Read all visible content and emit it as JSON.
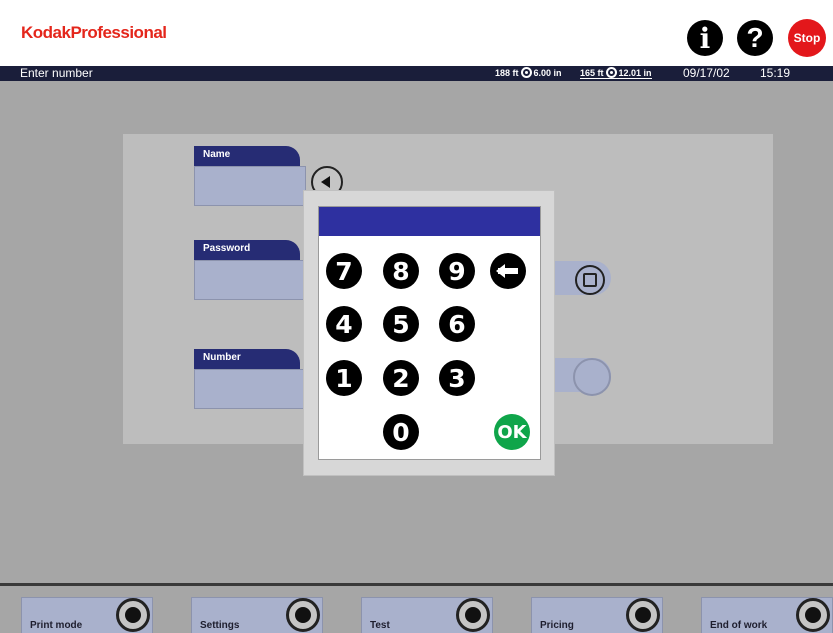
{
  "header": {
    "brand_bold": "Kodak",
    "brand_rest": "Professional",
    "info_glyph": "i",
    "help_glyph": "?",
    "stop_label": "Stop"
  },
  "status": {
    "title": "Enter number",
    "roll1_length": "188 ft",
    "roll1_width": "6.00 in",
    "roll2_length": "165 ft",
    "roll2_width": "12.01 in",
    "date": "09/17/02",
    "time": "15:19"
  },
  "form": {
    "name_label": "Name",
    "password_label": "Password",
    "number_label": "Number"
  },
  "keypad": {
    "display_value": "",
    "keys": [
      "7",
      "8",
      "9",
      "4",
      "5",
      "6",
      "1",
      "2",
      "3",
      "0"
    ],
    "ok_label": "OK"
  },
  "bottom_bar": {
    "buttons": [
      "Print mode",
      "Settings",
      "Test",
      "Pricing",
      "End of work"
    ]
  },
  "colors": {
    "brand_red": "#e4261b",
    "status_bar": "#1a1e3a",
    "field_tab": "#262c74",
    "keypad_display": "#2e30a0",
    "ok_green": "#0fa54a",
    "stop_red": "#e3171b"
  },
  "icons": {
    "info": "info-icon",
    "help": "help-icon",
    "stop": "stop-icon",
    "back": "arrow-left-icon",
    "roll": "paper-roll-icon"
  }
}
